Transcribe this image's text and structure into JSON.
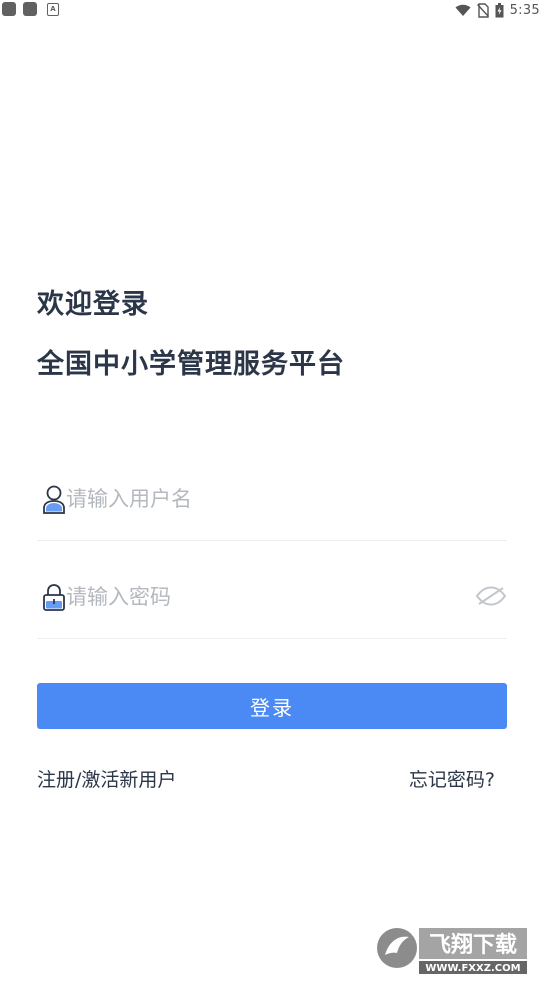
{
  "status_bar": {
    "time": "5:35",
    "icons": [
      "notification-square-icon",
      "notification-square-icon",
      "a-badge-icon",
      "wifi-icon",
      "no-sim-icon",
      "battery-icon"
    ],
    "a_badge": "A"
  },
  "login": {
    "welcome": "欢迎登录",
    "platform_name": "全国中小学管理服务平台",
    "username_placeholder": "请输入用户名",
    "password_placeholder": "请输入密码",
    "submit_label": "登录",
    "register_link": "注册/激活新用户",
    "forgot_link": "忘记密码?"
  },
  "watermark": {
    "brand": "飞翔下载",
    "url": "WWW.FXXZ.COM"
  },
  "colors": {
    "primary_button": "#4b8af5",
    "title_text": "#2b3648",
    "placeholder_text": "#b4b8bf",
    "icon_stroke": "#2b3648"
  }
}
